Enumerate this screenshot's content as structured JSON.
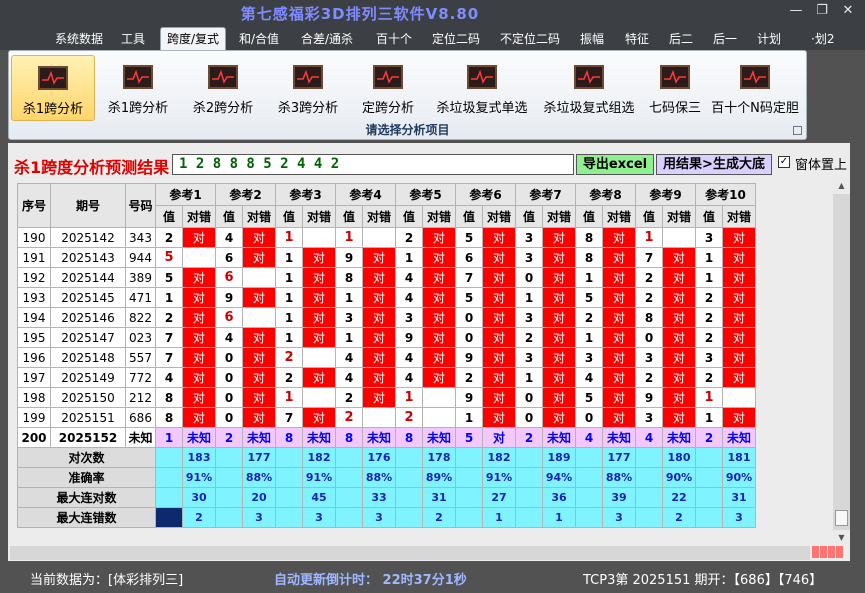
{
  "window": {
    "title": "第七感福彩3D排列三软件V8.80",
    "minimize": "—",
    "restore": "❐",
    "close": "✕"
  },
  "menu": [
    "系统数据",
    "工具",
    "跨度/复式",
    "和/合值",
    "合差/通杀",
    "百十个",
    "定位二码",
    "不定位二码",
    "振幅",
    "特征",
    "后二",
    "后一",
    "计划",
    "·划2"
  ],
  "menu_active": 2,
  "ribbon": {
    "buttons": [
      "杀1跨分析",
      "杀1跨分析",
      "杀2跨分析",
      "杀3跨分析",
      "定跨分析",
      "杀垃圾复式单选",
      "杀垃圾复式组选",
      "七码保三",
      "百十个N码定胆"
    ],
    "active": 0,
    "caption": "请选择分析项目"
  },
  "result": {
    "title": "杀1跨度分析预测结果",
    "value": "1 2 8 8 8 5 2 4 4 2"
  },
  "buttons": {
    "excel": "导出excel",
    "generate": "用结果>生成大底"
  },
  "topmost": {
    "label": "窗体置上",
    "checked": "✓"
  },
  "table": {
    "head": {
      "seq": "序号",
      "period": "期号",
      "code": "号码",
      "val": "值",
      "mark": "对错"
    },
    "refs": [
      "参考1",
      "参考2",
      "参考3",
      "参考4",
      "参考5",
      "参考6",
      "参考7",
      "参考8",
      "参考9",
      "参考10"
    ],
    "rows": [
      {
        "seq": "190",
        "period": "2025142",
        "code": "343",
        "cells": [
          [
            "2",
            "对"
          ],
          [
            "4",
            "对"
          ],
          [
            "1",
            ""
          ],
          [
            "1",
            ""
          ],
          [
            "2",
            "对"
          ],
          [
            "5",
            "对"
          ],
          [
            "3",
            "对"
          ],
          [
            "8",
            "对"
          ],
          [
            "1",
            ""
          ],
          [
            "3",
            "对"
          ]
        ]
      },
      {
        "seq": "191",
        "period": "2025143",
        "code": "944",
        "cells": [
          [
            "5",
            ""
          ],
          [
            "6",
            "对"
          ],
          [
            "1",
            "对"
          ],
          [
            "9",
            "对"
          ],
          [
            "1",
            "对"
          ],
          [
            "6",
            "对"
          ],
          [
            "3",
            "对"
          ],
          [
            "8",
            "对"
          ],
          [
            "7",
            "对"
          ],
          [
            "1",
            "对"
          ]
        ]
      },
      {
        "seq": "192",
        "period": "2025144",
        "code": "389",
        "cells": [
          [
            "5",
            "对"
          ],
          [
            "6",
            ""
          ],
          [
            "1",
            "对"
          ],
          [
            "8",
            "对"
          ],
          [
            "4",
            "对"
          ],
          [
            "7",
            "对"
          ],
          [
            "0",
            "对"
          ],
          [
            "1",
            "对"
          ],
          [
            "2",
            "对"
          ],
          [
            "1",
            "对"
          ]
        ]
      },
      {
        "seq": "193",
        "period": "2025145",
        "code": "471",
        "cells": [
          [
            "1",
            "对"
          ],
          [
            "9",
            "对"
          ],
          [
            "1",
            "对"
          ],
          [
            "1",
            "对"
          ],
          [
            "4",
            "对"
          ],
          [
            "5",
            "对"
          ],
          [
            "1",
            "对"
          ],
          [
            "5",
            "对"
          ],
          [
            "2",
            "对"
          ],
          [
            "2",
            "对"
          ]
        ]
      },
      {
        "seq": "194",
        "period": "2025146",
        "code": "822",
        "cells": [
          [
            "2",
            "对"
          ],
          [
            "6",
            ""
          ],
          [
            "1",
            "对"
          ],
          [
            "3",
            "对"
          ],
          [
            "3",
            "对"
          ],
          [
            "0",
            "对"
          ],
          [
            "3",
            "对"
          ],
          [
            "2",
            "对"
          ],
          [
            "8",
            "对"
          ],
          [
            "2",
            "对"
          ]
        ]
      },
      {
        "seq": "195",
        "period": "2025147",
        "code": "023",
        "cells": [
          [
            "7",
            "对"
          ],
          [
            "4",
            "对"
          ],
          [
            "1",
            "对"
          ],
          [
            "1",
            "对"
          ],
          [
            "9",
            "对"
          ],
          [
            "0",
            "对"
          ],
          [
            "2",
            "对"
          ],
          [
            "1",
            "对"
          ],
          [
            "0",
            "对"
          ],
          [
            "2",
            "对"
          ]
        ]
      },
      {
        "seq": "196",
        "period": "2025148",
        "code": "557",
        "cells": [
          [
            "7",
            "对"
          ],
          [
            "0",
            "对"
          ],
          [
            "2",
            ""
          ],
          [
            "4",
            "对"
          ],
          [
            "4",
            "对"
          ],
          [
            "9",
            "对"
          ],
          [
            "3",
            "对"
          ],
          [
            "3",
            "对"
          ],
          [
            "3",
            "对"
          ],
          [
            "3",
            "对"
          ]
        ]
      },
      {
        "seq": "197",
        "period": "2025149",
        "code": "772",
        "cells": [
          [
            "4",
            "对"
          ],
          [
            "0",
            "对"
          ],
          [
            "2",
            "对"
          ],
          [
            "4",
            "对"
          ],
          [
            "4",
            "对"
          ],
          [
            "2",
            "对"
          ],
          [
            "1",
            "对"
          ],
          [
            "4",
            "对"
          ],
          [
            "2",
            "对"
          ],
          [
            "2",
            "对"
          ]
        ]
      },
      {
        "seq": "198",
        "period": "2025150",
        "code": "212",
        "cells": [
          [
            "8",
            "对"
          ],
          [
            "0",
            "对"
          ],
          [
            "1",
            ""
          ],
          [
            "2",
            "对"
          ],
          [
            "1",
            ""
          ],
          [
            "9",
            "对"
          ],
          [
            "0",
            "对"
          ],
          [
            "5",
            "对"
          ],
          [
            "9",
            "对"
          ],
          [
            "1",
            ""
          ]
        ]
      },
      {
        "seq": "199",
        "period": "2025151",
        "code": "686",
        "cells": [
          [
            "8",
            "对"
          ],
          [
            "0",
            "对"
          ],
          [
            "7",
            "对"
          ],
          [
            "2",
            ""
          ],
          [
            "2",
            ""
          ],
          [
            "1",
            "对"
          ],
          [
            "0",
            "对"
          ],
          [
            "0",
            "对"
          ],
          [
            "3",
            "对"
          ],
          [
            "1",
            "对"
          ]
        ]
      }
    ],
    "pred": {
      "seq": "200",
      "period": "2025152",
      "code": "未知",
      "cells": [
        [
          "1",
          "未知"
        ],
        [
          "2",
          "未知"
        ],
        [
          "8",
          "未知"
        ],
        [
          "8",
          "未知"
        ],
        [
          "8",
          "未知"
        ],
        [
          "5",
          "对"
        ],
        [
          "2",
          "未知"
        ],
        [
          "4",
          "未知"
        ],
        [
          "4",
          "未知"
        ],
        [
          "2",
          "未知"
        ]
      ]
    },
    "stats": [
      {
        "label": "对次数",
        "values": [
          "183",
          "177",
          "182",
          "176",
          "178",
          "182",
          "189",
          "177",
          "180",
          "181"
        ]
      },
      {
        "label": "准确率",
        "values": [
          "91%",
          "88%",
          "91%",
          "88%",
          "89%",
          "91%",
          "94%",
          "88%",
          "90%",
          "90%"
        ]
      },
      {
        "label": "最大连对数",
        "values": [
          "30",
          "20",
          "45",
          "33",
          "31",
          "27",
          "36",
          "39",
          "22",
          "31"
        ]
      },
      {
        "label": "最大连错数",
        "values": [
          "2",
          "3",
          "3",
          "3",
          "2",
          "1",
          "1",
          "3",
          "2",
          "3"
        ]
      }
    ]
  },
  "status": {
    "left": "当前数据为：[体彩排列三]",
    "mid": "自动更新倒计时：  22时37分1秒",
    "right": "TCP3第 2025151 期开：【686】【746】"
  }
}
